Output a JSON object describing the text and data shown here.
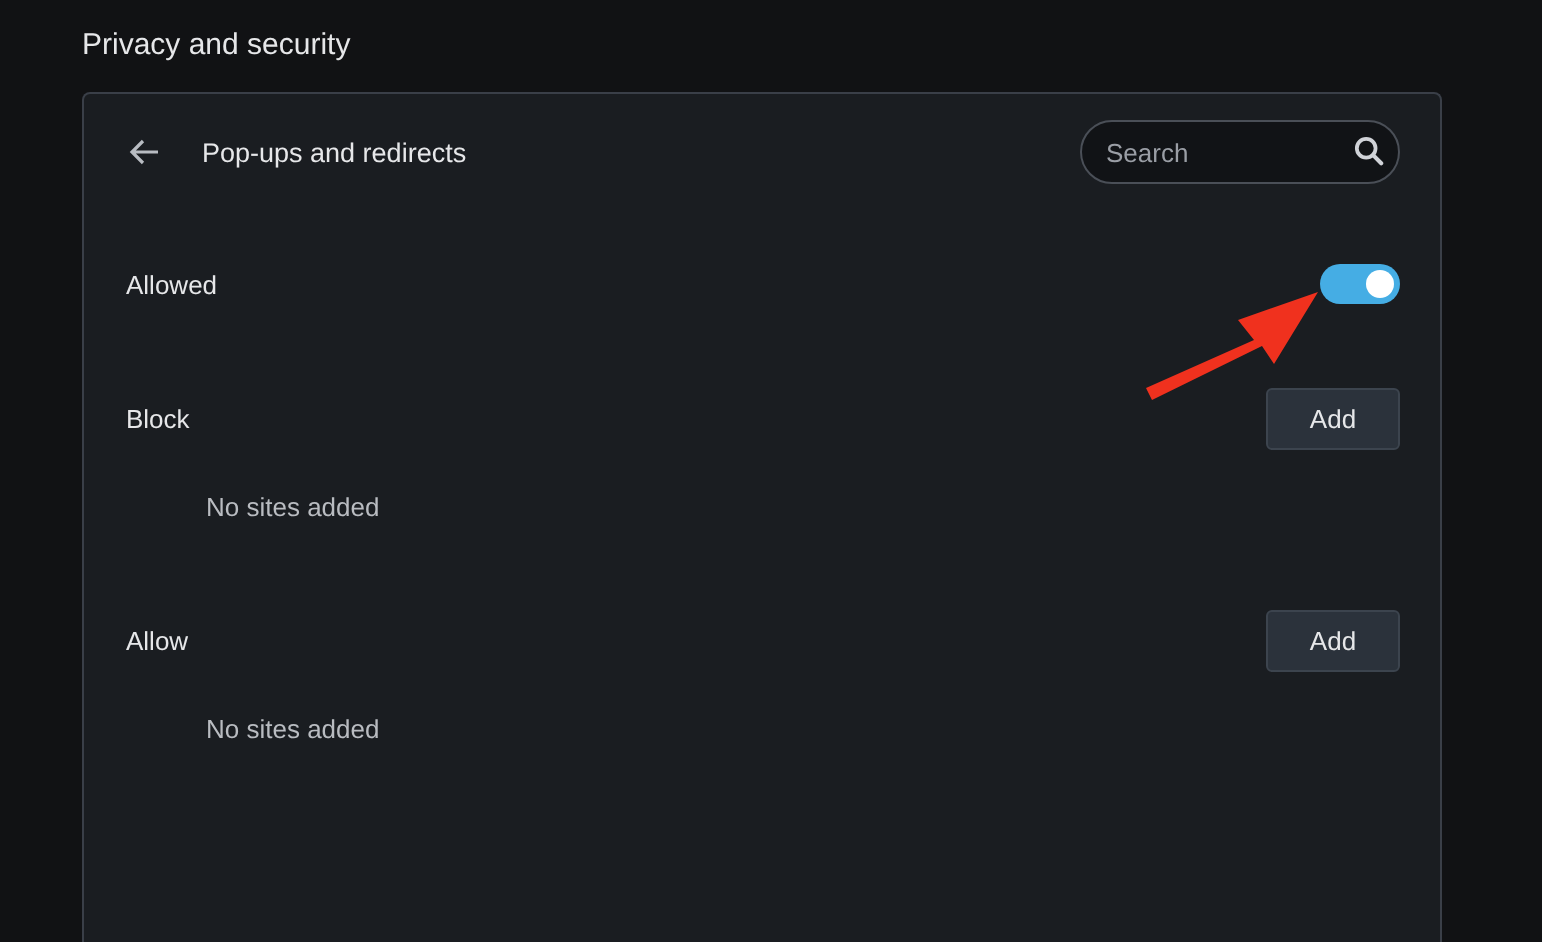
{
  "section_title": "Privacy and security",
  "panel": {
    "title": "Pop-ups and redirects",
    "search": {
      "placeholder": "Search"
    },
    "rows": [
      {
        "kind": "toggle",
        "label": "Allowed",
        "on": true
      },
      {
        "kind": "list",
        "label": "Block",
        "button": "Add",
        "empty_text": "No sites added"
      },
      {
        "kind": "list",
        "label": "Allow",
        "button": "Add",
        "empty_text": "No sites added"
      }
    ]
  }
}
